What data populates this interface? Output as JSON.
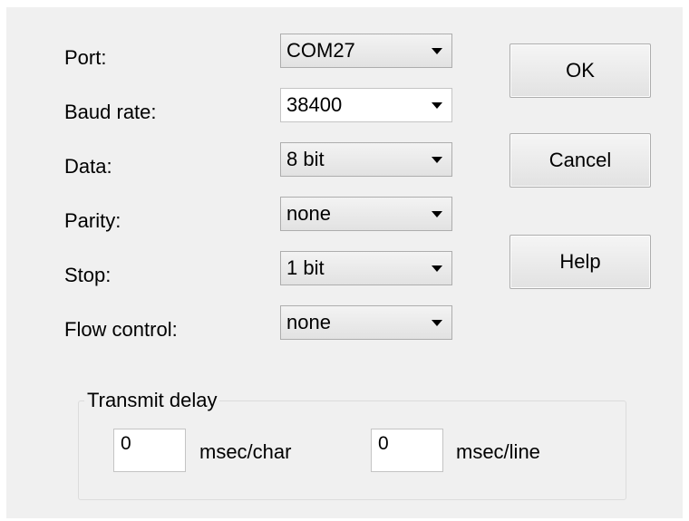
{
  "settings": {
    "port": {
      "label": "Port:",
      "value": "COM27"
    },
    "baud": {
      "label": "Baud rate:",
      "value": "38400"
    },
    "data": {
      "label": "Data:",
      "value": "8 bit"
    },
    "parity": {
      "label": "Parity:",
      "value": "none"
    },
    "stop": {
      "label": "Stop:",
      "value": "1 bit"
    },
    "flow": {
      "label": "Flow control:",
      "value": "none"
    }
  },
  "buttons": {
    "ok": "OK",
    "cancel": "Cancel",
    "help": "Help"
  },
  "transmit_delay": {
    "title": "Transmit delay",
    "char_value": "0",
    "char_unit": "msec/char",
    "line_value": "0",
    "line_unit": "msec/line"
  },
  "icons": {
    "dropdown_arrow": "chevron-down-icon"
  },
  "colors": {
    "dialog_background": "#f0f0f0",
    "control_border": "#adadad",
    "input_background": "#ffffff"
  }
}
